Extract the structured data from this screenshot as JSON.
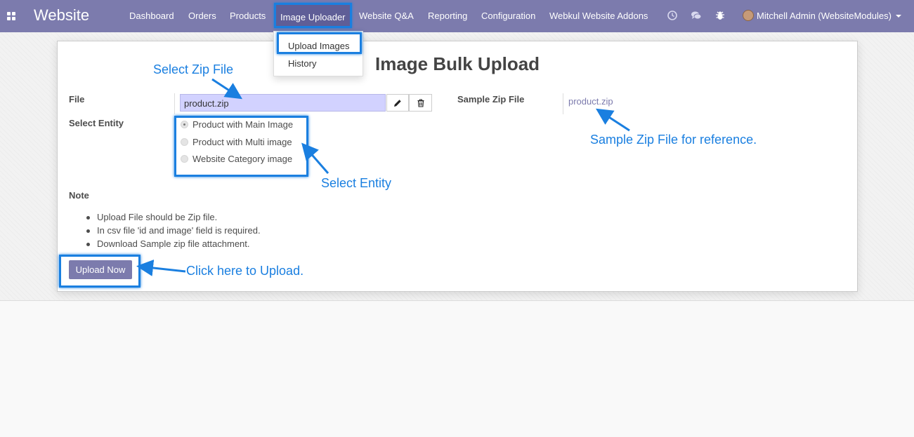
{
  "navbar": {
    "brand": "Website",
    "menu": [
      "Dashboard",
      "Orders",
      "Products",
      "Image Uploader",
      "Website Q&A",
      "Reporting",
      "Configuration",
      "Webkul Website Addons"
    ],
    "user": "Mitchell Admin (WebsiteModules)",
    "icons": [
      "apps-icon",
      "clock-icon",
      "chat-icon",
      "bug-icon"
    ]
  },
  "dropdown": {
    "items": [
      "Upload Images",
      "History"
    ]
  },
  "form": {
    "title": "Image Bulk Upload",
    "file_label": "File",
    "file_value": "product.zip",
    "sample_label": "Sample Zip File",
    "sample_link": "product.zip",
    "entity_label": "Select Entity",
    "entity_options": [
      "Product with Main Image",
      "Product with Multi image",
      "Website Category image"
    ],
    "entity_selected": 0,
    "note_label": "Note",
    "notes": [
      "Upload File should be Zip file.",
      "In csv file 'id and image' field is required.",
      "Download Sample zip file attachment."
    ],
    "upload_button": "Upload Now"
  },
  "annotations": {
    "select_zip": "Select Zip File",
    "sample_ref": "Sample Zip File for reference.",
    "select_entity": "Select Entity",
    "click_upload": "Click here to Upload."
  },
  "colors": {
    "navbar": "#7c7bad",
    "annotation": "#1a7fe0",
    "file_input": "#d2d2ff"
  }
}
